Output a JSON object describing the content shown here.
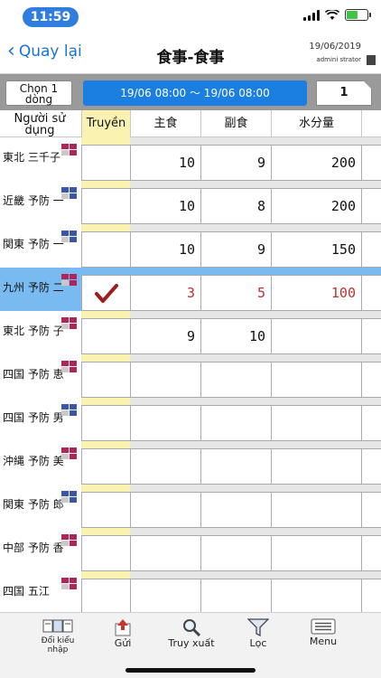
{
  "status_bar": {
    "time": "11:59"
  },
  "nav": {
    "back_label": "Quay lại",
    "title": "食事-食事",
    "date": "19/06/2019",
    "user": "admini strator"
  },
  "toolbar": {
    "select_label": "Chọn 1 dòng",
    "range_label": "19/06 08:00 〜 19/06 08:00",
    "page": "1"
  },
  "grid": {
    "columns": [
      "Người sử dụng",
      "Truyền",
      "主食",
      "副食",
      "水分量"
    ],
    "rows": [
      {
        "name": "東北 三千子",
        "mark": "red",
        "checked": false,
        "c1": "10",
        "c2": "9",
        "c3": "200"
      },
      {
        "name": "近畿 予防 一",
        "mark": "blue",
        "checked": false,
        "c1": "10",
        "c2": "8",
        "c3": "200"
      },
      {
        "name": "関東 予防 一",
        "mark": "blue",
        "checked": false,
        "c1": "10",
        "c2": "9",
        "c3": "150"
      },
      {
        "name": "九州 予防 二",
        "mark": "red",
        "checked": true,
        "selected": true,
        "c1": "3",
        "c2": "5",
        "c3": "100"
      },
      {
        "name": "東北 予防 子",
        "mark": "red",
        "checked": false,
        "c1": "9",
        "c2": "10",
        "c3": ""
      },
      {
        "name": "四国 予防 恵",
        "mark": "red",
        "checked": false,
        "c1": "",
        "c2": "",
        "c3": ""
      },
      {
        "name": "四国 予防 男",
        "mark": "blue",
        "checked": false,
        "c1": "",
        "c2": "",
        "c3": ""
      },
      {
        "name": "沖縄 予防 美",
        "mark": "red",
        "checked": false,
        "c1": "",
        "c2": "",
        "c3": ""
      },
      {
        "name": "関東 予防 郎",
        "mark": "blue",
        "checked": false,
        "c1": "",
        "c2": "",
        "c3": ""
      },
      {
        "name": "中部 予防 香",
        "mark": "red",
        "checked": false,
        "c1": "",
        "c2": "",
        "c3": ""
      },
      {
        "name": "四国 五江",
        "mark": "red",
        "checked": false,
        "c1": "",
        "c2": "",
        "c3": ""
      }
    ]
  },
  "tabs": [
    {
      "label": "Đổi kiểu nhập",
      "icon": "input-mode-icon"
    },
    {
      "label": "Gửi",
      "icon": "send-icon"
    },
    {
      "label": "Truy xuất",
      "icon": "search-icon"
    },
    {
      "label": "Lọc",
      "icon": "filter-icon"
    },
    {
      "label": "Menu",
      "icon": "menu-icon"
    }
  ],
  "colors": {
    "accent": "#1a7fe0",
    "selected_row": "#79bbf0",
    "mark_red": "#b0245a",
    "mark_blue": "#3a56a8",
    "yellow": "#faf2b0"
  }
}
